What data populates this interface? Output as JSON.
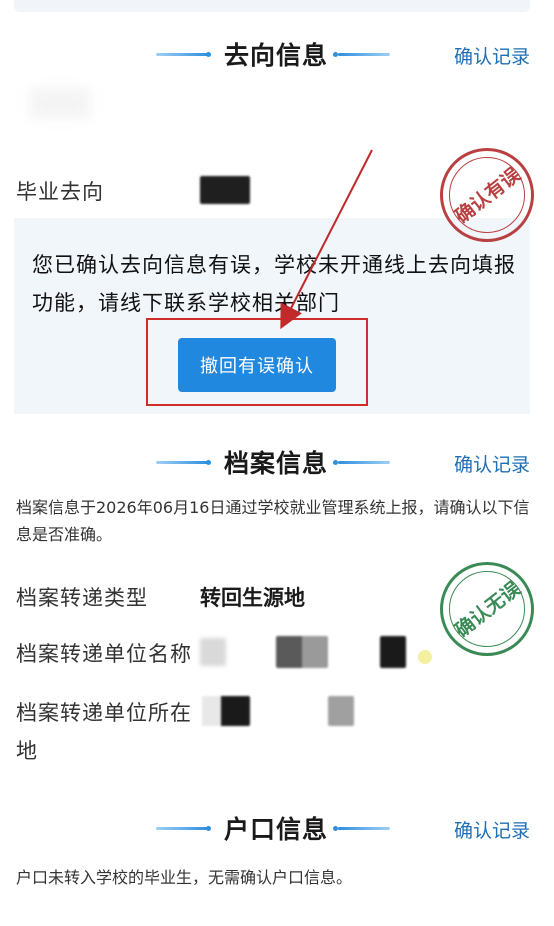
{
  "destination_section": {
    "title": "去向信息",
    "record_link": "确认记录",
    "field_label": "毕业去向",
    "stamp_text": "确认有误",
    "notice": "您已确认去向信息有误，学校未开通线上去向填报功能，请线下联系学校相关部门",
    "withdraw_button": "撤回有误确认"
  },
  "archive_section": {
    "title": "档案信息",
    "record_link": "确认记录",
    "description": "档案信息于2026年06月16日通过学校就业管理系统上报，请确认以下信息是否准确。",
    "stamp_text": "确认无误",
    "fields": [
      {
        "label": "档案转递类型",
        "value": "转回生源地"
      },
      {
        "label": "档案转递单位名称",
        "value": ""
      },
      {
        "label": "档案转递单位所在地",
        "value": ""
      }
    ]
  },
  "hukou_section": {
    "title": "户口信息",
    "record_link": "确认记录",
    "description": "户口未转入学校的毕业生，无需确认户口信息。"
  },
  "colors": {
    "accent": "#2188e0",
    "link": "#1f6fb5",
    "error_stamp": "#b94040",
    "ok_stamp": "#3a8a56",
    "highlight_box": "#d12d2d"
  }
}
